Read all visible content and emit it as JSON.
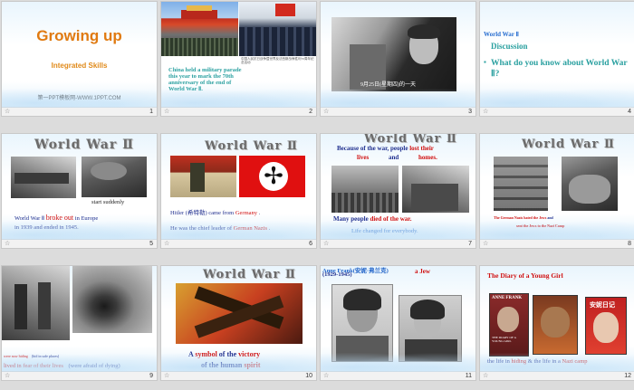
{
  "slide_numbers": [
    "1",
    "2",
    "3",
    "4",
    "5",
    "6",
    "7",
    "8",
    "9",
    "10",
    "11",
    "12"
  ],
  "star_icon": "☆",
  "slide1": {
    "title": "Growing up",
    "subtitle": "Integrated Skills",
    "credit": "第一PPT模板网-WWW.1PPT.COM"
  },
  "slide2": {
    "caption": "China held a military parade this year to mark the 70th anniversary of the end of World War Ⅱ.",
    "photo_note": "中国人民抗日战争暨世界反法西斯战争胜利70周年纪念活动"
  },
  "slide3": {
    "photo_caption": "9月25日(星期四)的一天"
  },
  "slide4": {
    "heading": "World War Ⅱ",
    "discussion": "Discussion",
    "question": "What do you know about World War Ⅱ?"
  },
  "slide5": {
    "title": "World War Ⅱ",
    "start": "start suddenly",
    "line1_a": "World War Ⅱ",
    "line1_b": "broke out",
    "line1_c": "in Europe",
    "line2": "in 1939 and  ended  in 1945."
  },
  "slide6": {
    "title": "World War Ⅱ",
    "line1_a": "Hitler (希特勒) came from",
    "line1_b": "Germany",
    "line2_a": "He was the chief leader of",
    "line2_b": "German  Nazis"
  },
  "slide7": {
    "title": "World War Ⅱ",
    "head_a": "Because of the war, people",
    "head_b": "lost their",
    "head_c": "lives",
    "head_d": "and",
    "head_e": "homes.",
    "died_a": "Many people",
    "died_b": "died of the war.",
    "changed": "Life changed for everybody."
  },
  "slide8": {
    "title": "World War Ⅱ",
    "caption_a": "The German Nazis",
    "caption_b": "hated the Jews",
    "caption_c": "and",
    "caption_d": "sent the Jews to the Nazi Camp"
  },
  "slide9": {
    "hiding_a": "were now hiding",
    "hiding_b": "(hid in safe places)",
    "fear_a": "lived  in fear of their lives",
    "fear_b": "(were afraid of dying)"
  },
  "slide10": {
    "title": "World War Ⅱ",
    "line1_a": "A",
    "line1_b": "symbol",
    "line1_c": "of the",
    "line1_d": "victory",
    "line2_a": "of the human",
    "line2_b": "spirit"
  },
  "slide11": {
    "name": "Anne Frank(安妮·弗兰克)",
    "years": "(1929-1945)",
    "jew": "a Jew"
  },
  "slide12": {
    "title": "The Diary of a Young Girl",
    "book1": "ANNE FRANK",
    "book1b": "THE DIARY OF A YOUNG GIRL",
    "book3": "安妮日记",
    "caption_a": "the life in",
    "caption_b": "hiding",
    "caption_c": "& the life in a",
    "caption_d": "Nazi camp"
  },
  "colors": {
    "title_orange": "#e07a10",
    "skills_orange": "#e08a1a",
    "navy": "#1f2f8f",
    "red": "#d01010",
    "blue_text": "#1f62c8",
    "green": "#3aaa2a",
    "teal": "#2aa0a0"
  }
}
